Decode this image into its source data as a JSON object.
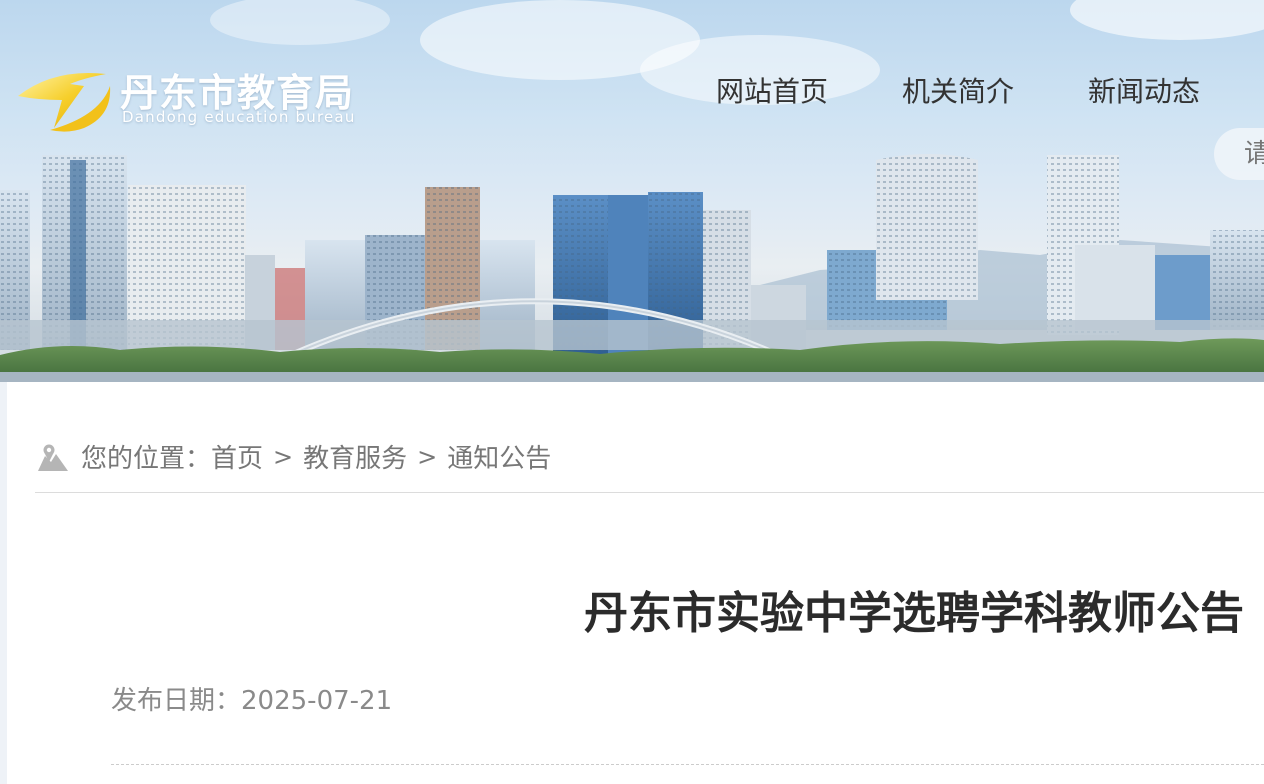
{
  "header": {
    "logo_cn": "丹东市教育局",
    "logo_en": "Dandong education bureau",
    "nav": [
      {
        "label": "网站首页"
      },
      {
        "label": "机关简介"
      },
      {
        "label": "新闻动态"
      }
    ],
    "search_placeholder": "请"
  },
  "breadcrumb": {
    "prefix": "您的位置：",
    "items": [
      {
        "label": "首页"
      },
      {
        "label": "教育服务"
      },
      {
        "label": "通知公告"
      }
    ],
    "separator": ">"
  },
  "article": {
    "title": "丹东市实验中学选聘学科教师公告",
    "date_label": "发布日期：",
    "date": "2025-07-21"
  },
  "colors": {
    "accent_logo": "#f4c21a",
    "text_main": "#2b2b2b",
    "text_muted": "#777777"
  },
  "icons": {
    "logo": "dandong-education-logo-icon",
    "location": "map-location-icon"
  }
}
